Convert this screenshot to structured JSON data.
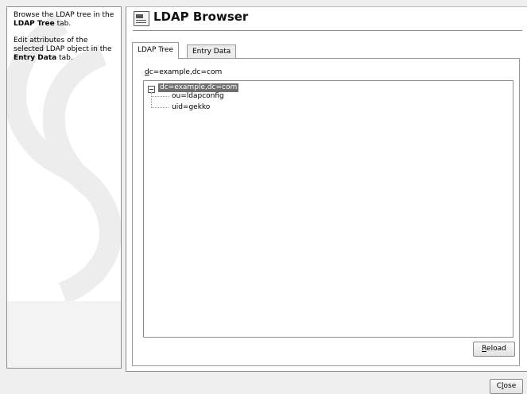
{
  "help": {
    "p1_a": "Browse the LDAP tree in the ",
    "p1_bold": "LDAP Tree",
    "p1_b": " tab.",
    "p2_a": "Edit attributes of the selected LDAP object in the ",
    "p2_bold": "Entry Data",
    "p2_b": " tab."
  },
  "header": {
    "title": "LDAP Browser",
    "icon": "ldap-browser-icon"
  },
  "tabs": [
    {
      "label": "LDAP Tree",
      "active": true
    },
    {
      "label": "Entry Data",
      "active": false
    }
  ],
  "base_dn": {
    "mnemonic": "d",
    "rest": "c=example,dc=com"
  },
  "tree": {
    "root": "dc=example,dc=com",
    "children": [
      "ou=ldapconfig",
      "uid=gekko"
    ]
  },
  "buttons": {
    "reload_mnemonic": "R",
    "reload_rest": "eload",
    "close_a": "C",
    "close_mnemonic": "l",
    "close_b": "ose"
  }
}
